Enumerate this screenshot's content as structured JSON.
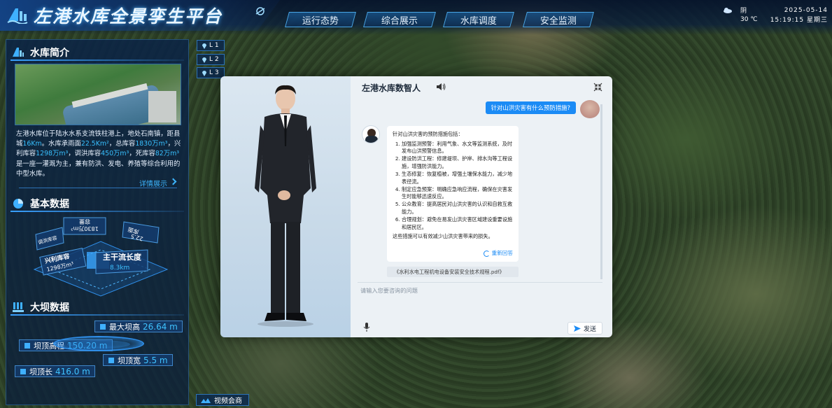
{
  "header": {
    "title": "左港水库全景孪生平台",
    "nav": [
      "运行态势",
      "综合展示",
      "水库调度",
      "安全监测"
    ],
    "weather": {
      "condition": "阴",
      "temperature": "30 ℃"
    },
    "date": "2025-05-14",
    "time_week": "15:19:15 星期三"
  },
  "levels": [
    "L 1",
    "L 2",
    "L 3"
  ],
  "intro": {
    "title": "水库简介",
    "text_parts": [
      {
        "t": "左港水库位于陆水水系支流铁柱港上，地处石南镇，距县城",
        "hl": false
      },
      {
        "t": "16Km",
        "hl": true
      },
      {
        "t": "。水库承雨面",
        "hl": false
      },
      {
        "t": "22.5Km²",
        "hl": true
      },
      {
        "t": "，总库容",
        "hl": false
      },
      {
        "t": "1830万m³",
        "hl": true
      },
      {
        "t": "，兴利库容",
        "hl": false
      },
      {
        "t": "1298万m³",
        "hl": true
      },
      {
        "t": "，调洪库容",
        "hl": false
      },
      {
        "t": "450万m³",
        "hl": true
      },
      {
        "t": "，死库容",
        "hl": false
      },
      {
        "t": "82万m³",
        "hl": true
      },
      {
        "t": "是一座一灌溉为主，兼有防洪、发电、养殖等综合利用的中型水库。",
        "hl": false
      }
    ],
    "more": "详情展示"
  },
  "basic": {
    "title": "基本数据",
    "cards": [
      {
        "label": "容量",
        "value": "1830万m³"
      },
      {
        "label": "库面",
        "value": "22.5"
      },
      {
        "label": "调洪库容",
        "value": ""
      },
      {
        "label": "兴利库容",
        "value": "1298万m³"
      },
      {
        "label": "主干流长度",
        "value": "8.3km"
      }
    ]
  },
  "dam": {
    "title": "大坝数据",
    "max_height_label": "最大坝高",
    "max_height": "26.64 m",
    "crest_elev_label": "坝顶高程",
    "crest_elev": "150.20 m",
    "crest_width_label": "坝顶宽",
    "crest_width": "5.5 m",
    "crest_length_label": "坝顶长",
    "crest_length": "416.0 m"
  },
  "video": "视频会商",
  "chat": {
    "title": "左港水库数智人",
    "user_question": "针对山洪灾害有什么预防措施?",
    "intro_line": "针对山洪灾害的预防措施包括：",
    "items": [
      "加强监测预警：利用气象、水文等监测系统，及时发布山洪预警信息。",
      "建设防洪工程：修建堤坝、护岸、排水沟等工程设施，增强防洪能力。",
      "生态修复：恢复植被，增强土壤保水能力，减少地表径流。",
      "制定应急预案：明确应急响应流程，确保在灾害发生时能够迅速反应。",
      "公众教育：提高居民对山洪灾害的认识和自救互救能力。",
      "合理规划：避免在易发山洪灾害区域建设重要设施和居民区。"
    ],
    "closing": "这些措施可以有效减少山洪灾害带来的损失。",
    "regen": "重新回答",
    "doc_ref": "《水利水电工程机电设备安装安全技术规程.pdf》",
    "placeholder": "请输入您要咨询的问题",
    "send": "发送"
  }
}
